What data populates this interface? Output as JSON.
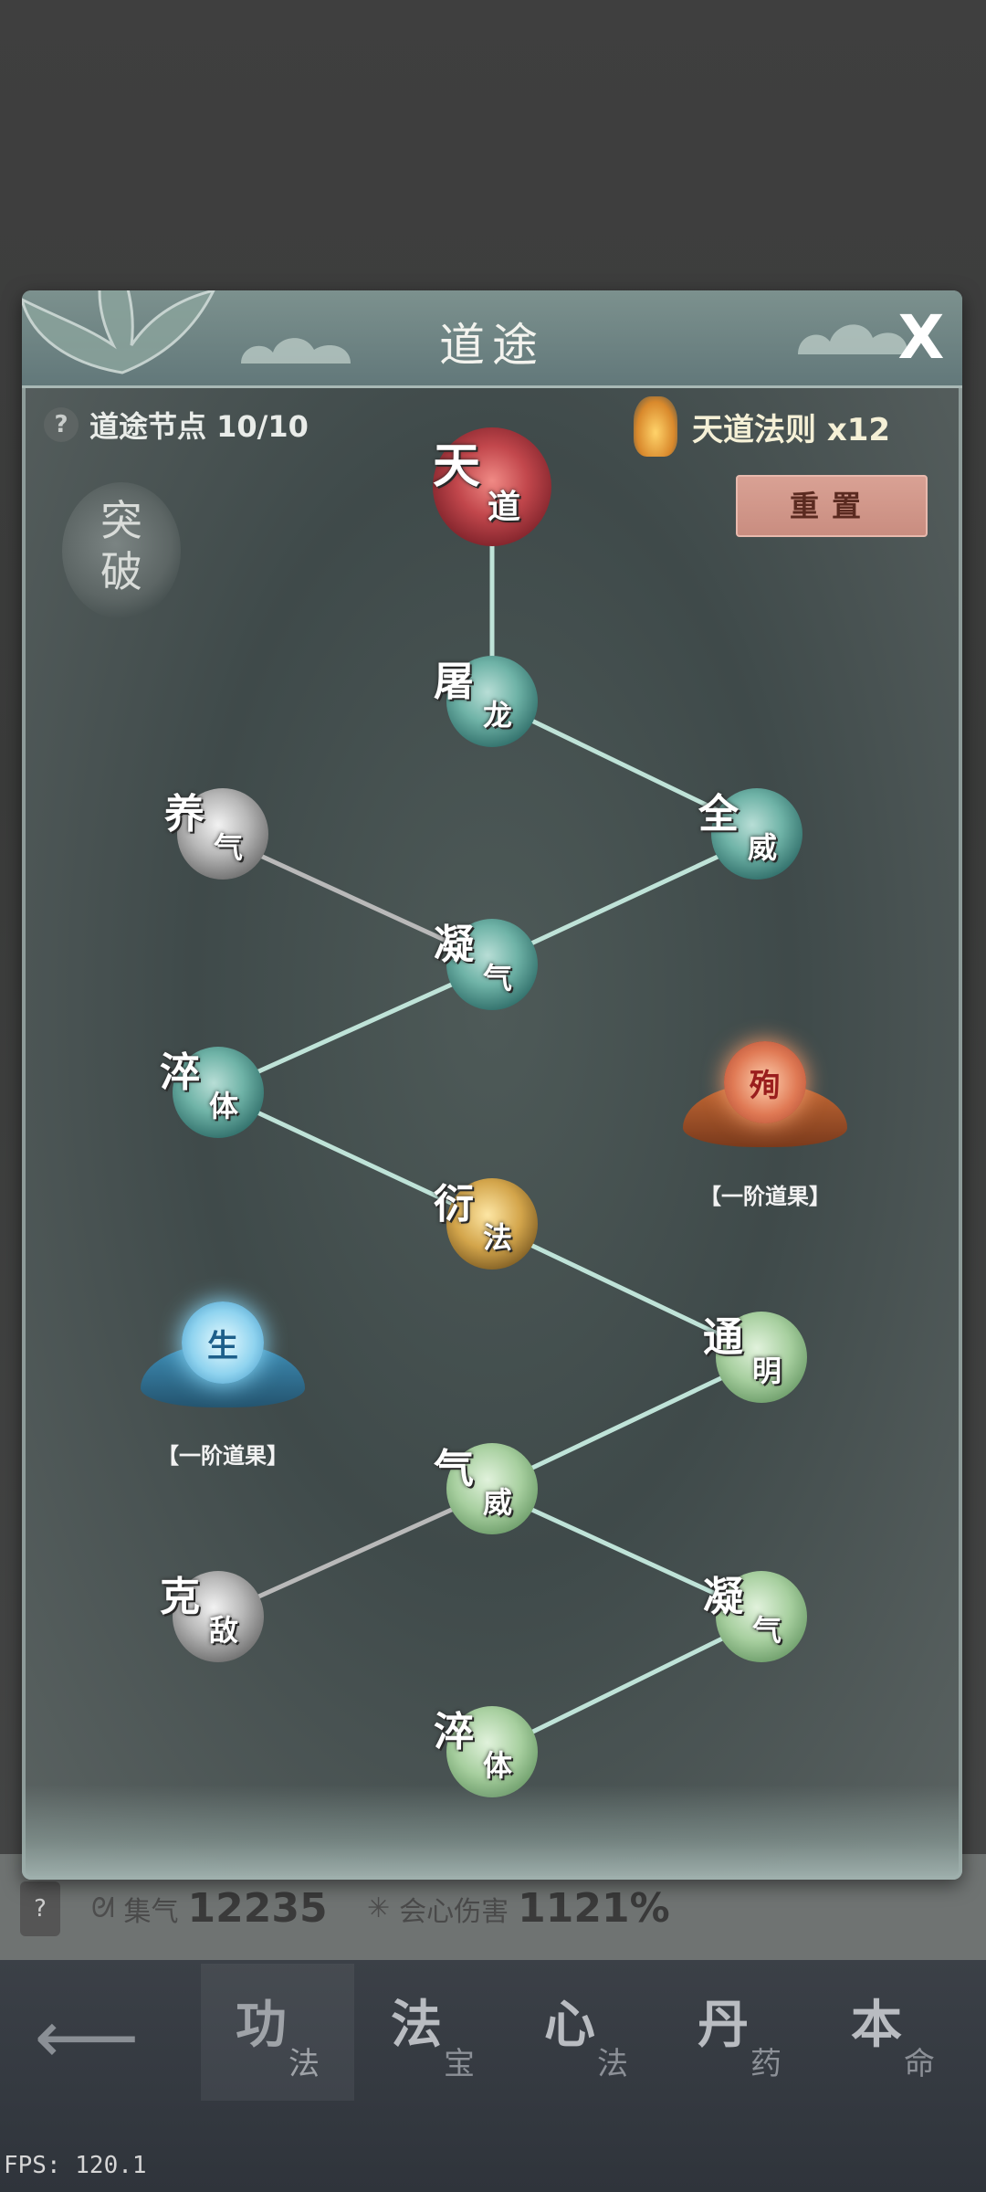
{
  "modal": {
    "title": "道途",
    "close_label": "X",
    "node_count_label": "道途节点 10/10",
    "currency_label": "天道法则 x12",
    "reset_label": "重置",
    "breakthrough_label": "突破"
  },
  "nodes": [
    {
      "id": "tiandao",
      "big": "天",
      "small": "道",
      "style": "red"
    },
    {
      "id": "tulong",
      "big": "屠",
      "small": "龙",
      "style": "teal"
    },
    {
      "id": "quanwei",
      "big": "全",
      "small": "威",
      "style": "teal"
    },
    {
      "id": "yangqi",
      "big": "养",
      "small": "气",
      "style": "grey"
    },
    {
      "id": "ningqi1",
      "big": "凝",
      "small": "气",
      "style": "teal"
    },
    {
      "id": "cuiti1",
      "big": "淬",
      "small": "体",
      "style": "teal"
    },
    {
      "id": "yanfa",
      "big": "衍",
      "small": "法",
      "style": "gold"
    },
    {
      "id": "tongming",
      "big": "通",
      "small": "明",
      "style": "green"
    },
    {
      "id": "qiwei",
      "big": "气",
      "small": "威",
      "style": "green"
    },
    {
      "id": "kedi",
      "big": "克",
      "small": "敌",
      "style": "grey"
    },
    {
      "id": "ningqi2",
      "big": "凝",
      "small": "气",
      "style": "green"
    },
    {
      "id": "cuiti2",
      "big": "淬",
      "small": "体",
      "style": "green"
    }
  ],
  "fruits": [
    {
      "glyph": "殉",
      "label": "【一阶道果】",
      "style": "orange"
    },
    {
      "glyph": "生",
      "label": "【一阶道果】",
      "style": "blue"
    }
  ],
  "stats": {
    "help": "?",
    "qi_icon": "swirl-icon",
    "qi_label": "集气",
    "qi_value": "12235",
    "crit_icon": "sparkle-icon",
    "crit_label": "会心伤害",
    "crit_value": "1121%"
  },
  "bottom_nav": {
    "back_icon": "back-arrow-icon",
    "tabs": [
      {
        "big": "功",
        "small": "法",
        "active": true
      },
      {
        "big": "法",
        "small": "宝",
        "active": false
      },
      {
        "big": "心",
        "small": "法",
        "active": false
      },
      {
        "big": "丹",
        "small": "药",
        "active": false
      },
      {
        "big": "本",
        "small": "命",
        "active": false
      }
    ]
  },
  "fps": "FPS: 120.1",
  "colors": {
    "connector_active": "#bfe3d8",
    "connector_inactive": "#b9b9b9",
    "reset_bg": "#d39a8d"
  }
}
